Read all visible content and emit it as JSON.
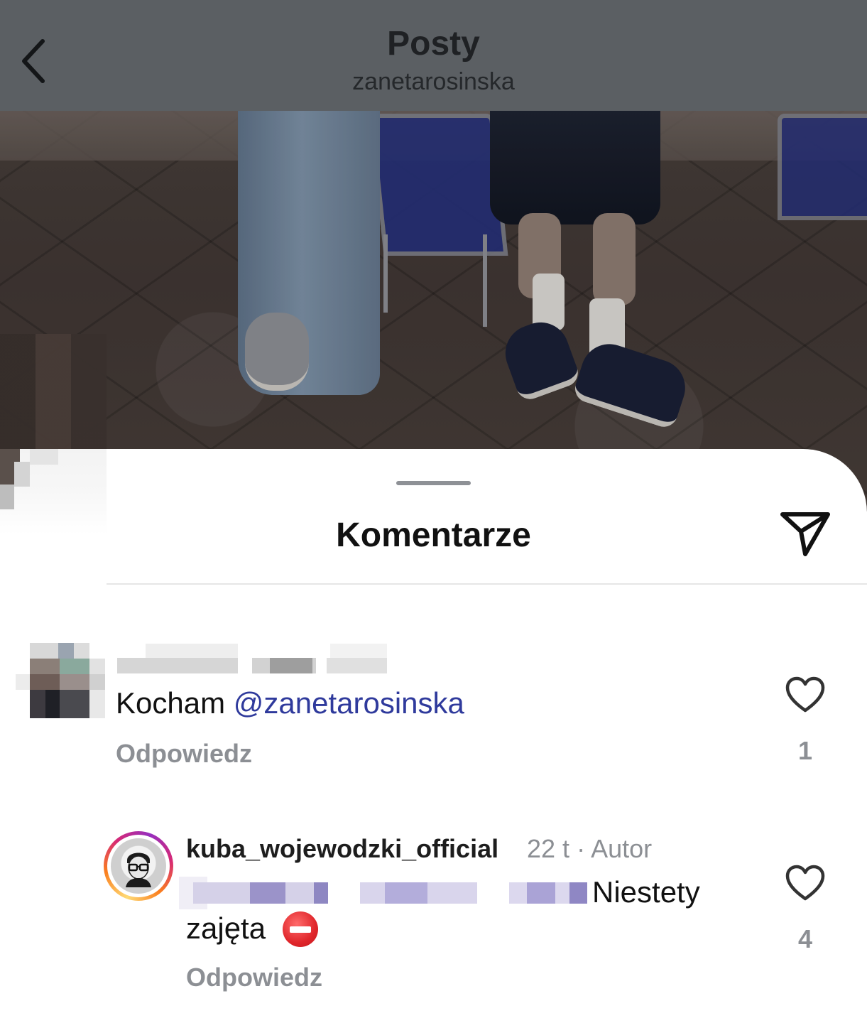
{
  "header": {
    "title": "Posty",
    "subtitle": "zanetarosinska",
    "back_icon": "chevron-left-icon"
  },
  "sheet": {
    "title": "Komentarze",
    "share_icon": "send-icon"
  },
  "comments": [
    {
      "username": "",
      "text": "Kocham ",
      "mention": "@zanetarosinska",
      "reply_label": "Odpowiedz",
      "likes": "1",
      "like_icon": "heart-outline-icon"
    },
    {
      "username": "kuba_wojewodzki_official",
      "time": "22 t",
      "separator": "·",
      "badge": "Autor",
      "text_line1": "Niestety",
      "text_line2": "zajęta",
      "emoji": "⛔",
      "reply_label": "Odpowiedz",
      "likes": "4",
      "like_icon": "heart-outline-icon"
    }
  ],
  "colors": {
    "header_bg": "#5b5f63",
    "mention": "#2f3a9c",
    "muted": "#8c8f94"
  }
}
